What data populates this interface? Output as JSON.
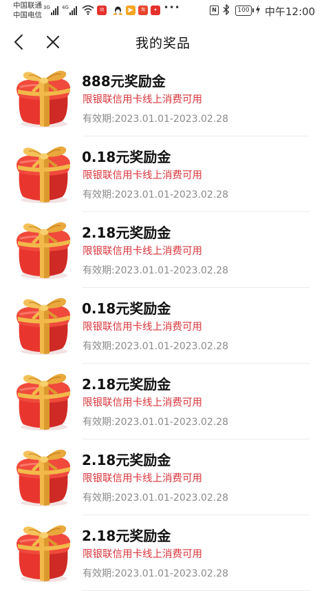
{
  "status_bar": {
    "carrier_1": "中国联通",
    "carrier_2": "中国电信",
    "net_1": "3G",
    "net_2": "4G",
    "battery": "100",
    "time": "中午12:00",
    "notification_icons": [
      "app-icon-red",
      "chat-icon",
      "app-icon-orange",
      "app-icon-red-2",
      "app-icon-red-3"
    ]
  },
  "nav": {
    "back_icon": "chevron-left-icon",
    "close_icon": "close-icon",
    "title": "我的奖品"
  },
  "prizes": [
    {
      "title": "888元奖励金",
      "limit": "限银联信用卡线上消费可用",
      "validity_label": "有效期:",
      "validity": "2023.01.01-2023.02.28"
    },
    {
      "title": "0.18元奖励金",
      "limit": "限银联信用卡线上消费可用",
      "validity_label": "有效期:",
      "validity": "2023.01.01-2023.02.28"
    },
    {
      "title": "2.18元奖励金",
      "limit": "限银联信用卡线上消费可用",
      "validity_label": "有效期:",
      "validity": "2023.01.01-2023.02.28"
    },
    {
      "title": "0.18元奖励金",
      "limit": "限银联信用卡线上消费可用",
      "validity_label": "有效期:",
      "validity": "2023.01.01-2023.02.28"
    },
    {
      "title": "2.18元奖励金",
      "limit": "限银联信用卡线上消费可用",
      "validity_label": "有效期:",
      "validity": "2023.01.01-2023.02.28"
    },
    {
      "title": "2.18元奖励金",
      "limit": "限银联信用卡线上消费可用",
      "validity_label": "有效期:",
      "validity": "2023.01.01-2023.02.28"
    },
    {
      "title": "2.18元奖励金",
      "limit": "限银联信用卡线上消费可用",
      "validity_label": "有效期:",
      "validity": "2023.01.01-2023.02.28"
    }
  ],
  "colors": {
    "limit_text": "#d8343b",
    "gift_red": "#e8362f",
    "ribbon_gold": "#f2b94a"
  }
}
